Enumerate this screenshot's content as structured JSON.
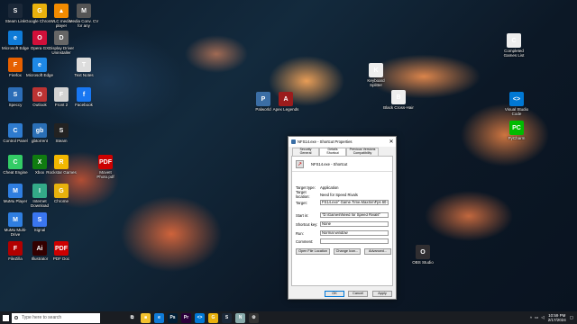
{
  "desktop": {
    "icons": [
      {
        "label": "Steam Link",
        "glyph": "S",
        "color": "#1b2838",
        "pos": "a"
      },
      {
        "label": "Google Chrome",
        "glyph": "G",
        "color": "#e8b10d",
        "pos": "b"
      },
      {
        "label": "VLC media player",
        "glyph": "▲",
        "color": "#f28b00",
        "pos": "c"
      },
      {
        "label": "Media Conv. CV for any",
        "glyph": "M",
        "color": "#555",
        "pos": "d"
      },
      {
        "label": "Microsoft Edge",
        "glyph": "e",
        "color": "#0f7bd7",
        "pos": "e"
      },
      {
        "label": "Opera GX",
        "glyph": "O",
        "color": "#d0103a",
        "pos": "f"
      },
      {
        "label": "Display Driver Uninstaller",
        "glyph": "D",
        "color": "#666",
        "pos": "g"
      },
      {
        "label": "Firefox",
        "glyph": "F",
        "color": "#e66000",
        "pos": "h"
      },
      {
        "label": "Microsoft Edge",
        "glyph": "e",
        "color": "#1e88e5",
        "pos": "i"
      },
      {
        "label": "Text Notes",
        "glyph": "T",
        "color": "#ddd",
        "pos": "j"
      },
      {
        "label": "Speccy",
        "glyph": "S",
        "color": "#2c6db7",
        "pos": "k"
      },
      {
        "label": "Outlook",
        "glyph": "O",
        "color": "#b33",
        "pos": "l"
      },
      {
        "label": "Front 2",
        "glyph": "F",
        "color": "#d3d3d3",
        "pos": "m"
      },
      {
        "label": "Facebook",
        "glyph": "f",
        "color": "#1877f2",
        "pos": "n"
      },
      {
        "label": "Control Panel",
        "glyph": "C",
        "color": "#2e7bcf",
        "pos": "o"
      },
      {
        "label": "gbtorrent",
        "glyph": "gb",
        "color": "#2a6fb6",
        "pos": "p"
      },
      {
        "label": "Steam",
        "glyph": "S",
        "color": "#222",
        "pos": "q"
      },
      {
        "label": "Cheat Engine",
        "glyph": "C",
        "color": "#3c6",
        "pos": "r"
      },
      {
        "label": "Xbox",
        "glyph": "X",
        "color": "#107c10",
        "pos": "s"
      },
      {
        "label": "Rockstar Games",
        "glyph": "R",
        "color": "#f3b800",
        "pos": "t"
      },
      {
        "label": "MoveIt Photo.pdf",
        "glyph": "PDF",
        "color": "#c00",
        "pos": "u"
      },
      {
        "label": "MuMu Player",
        "glyph": "M",
        "color": "#2f7ee0",
        "pos": "v"
      },
      {
        "label": "Internet Download",
        "glyph": "I",
        "color": "#3a8",
        "pos": "w"
      },
      {
        "label": "Chrome",
        "glyph": "G",
        "color": "#e8b10d",
        "pos": "x"
      },
      {
        "label": "MuMu Multi-Drive",
        "glyph": "M",
        "color": "#2f7ee0",
        "pos": "y"
      },
      {
        "label": "Signal",
        "glyph": "S",
        "color": "#3a76f0",
        "pos": "z"
      },
      {
        "label": "FileZilla",
        "glyph": "F",
        "color": "#b20000",
        "pos": "aa"
      },
      {
        "label": "Illustrator",
        "glyph": "Ai",
        "color": "#330000",
        "pos": "bb"
      },
      {
        "label": "PDF Doc",
        "glyph": "PDF",
        "color": "#c00",
        "pos": "cc"
      },
      {
        "label": "Palworld",
        "glyph": "P",
        "color": "#3b6ea5",
        "pos": "dd"
      },
      {
        "label": "Apex Legends",
        "glyph": "A",
        "color": "#9b1c1c",
        "pos": "ee"
      },
      {
        "label": "Keyboard Splitter",
        "glyph": "K",
        "color": "#eee",
        "pos": "ff"
      },
      {
        "label": "Black Cross-Hair",
        "glyph": "B",
        "color": "#eee",
        "pos": "gg"
      },
      {
        "label": "Visual Studio Code",
        "glyph": "<>",
        "color": "#0078d4",
        "pos": "hh"
      },
      {
        "label": "Completed Games List",
        "glyph": "C",
        "color": "#eee",
        "pos": "ii"
      },
      {
        "label": "PyCharm",
        "glyph": "PC",
        "color": "#0b0",
        "pos": "jj"
      },
      {
        "label": "OBS Studio",
        "glyph": "O",
        "color": "#302e31",
        "pos": "kk"
      }
    ]
  },
  "dialog": {
    "title": "NFS14.exe - Shortcut Properties",
    "close_glyph": "✕",
    "tabs": [
      {
        "label": "Security"
      },
      {
        "label": "Details"
      },
      {
        "label": "Previous Versions"
      },
      {
        "label": "General"
      },
      {
        "label": "Shortcut"
      },
      {
        "label": "Compatibility"
      }
    ],
    "file_name": "NFS14.exe - Shortcut",
    "target_type_label": "Target type:",
    "target_type_value": "Application",
    "target_location_label": "Target location:",
    "target_location_value": "Need for Speed Rivals",
    "target_label": "Target:",
    "target_value": "FS14.exe\" Game.Time.MaxSimFps 60 Game.Time",
    "start_in_label": "Start in:",
    "start_in_value": "\"D:\\Games\\Need for Speed Rivals\"",
    "shortcut_key_label": "Shortcut key:",
    "shortcut_key_value": "None",
    "run_label": "Run:",
    "run_value": "Normal window",
    "comment_label": "Comment:",
    "comment_value": "",
    "open_file_location": "Open File Location",
    "change_icon": "Change Icon...",
    "advanced": "Advanced...",
    "ok": "OK",
    "cancel": "Cancel",
    "apply": "Apply"
  },
  "taskbar": {
    "search_placeholder": "Type here to search",
    "time": "10:59 PM",
    "date": "2/17/2024",
    "apps": [
      {
        "name": "task-view-icon",
        "glyph": "⧉",
        "color": "#1a1d22"
      },
      {
        "name": "file-explorer-icon",
        "glyph": "■",
        "color": "#f2c12e"
      },
      {
        "name": "edge-icon",
        "glyph": "e",
        "color": "#0f7bd7"
      },
      {
        "name": "photoshop-icon",
        "glyph": "Ps",
        "color": "#001e36"
      },
      {
        "name": "premiere-icon",
        "glyph": "Pr",
        "color": "#2a003a"
      },
      {
        "name": "vscode-icon",
        "glyph": "<>",
        "color": "#0078d4"
      },
      {
        "name": "chrome-icon",
        "glyph": "G",
        "color": "#e8b10d"
      },
      {
        "name": "steam-icon",
        "glyph": "S",
        "color": "#1b2838"
      },
      {
        "name": "notepad-icon",
        "glyph": "N",
        "color": "#8aa"
      },
      {
        "name": "settings-icon",
        "glyph": "⚙",
        "color": "#333"
      }
    ]
  }
}
